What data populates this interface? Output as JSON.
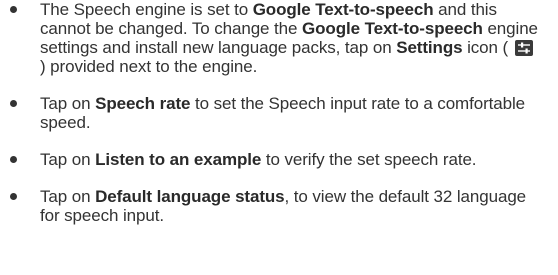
{
  "items": [
    {
      "parts": [
        {
          "t": "The Speech engine is set to ",
          "b": false
        },
        {
          "t": "Google Text-to-speech",
          "b": true
        },
        {
          "t": " and this cannot be changed. To change the ",
          "b": false
        },
        {
          "t": "Google Text-to-speech",
          "b": true
        },
        {
          "t": " engine settings and install new language packs, tap on ",
          "b": false
        },
        {
          "t": "Settings",
          "b": true
        },
        {
          "t": " icon ( ",
          "b": false
        },
        {
          "icon": "settings-sliders-icon"
        },
        {
          "t": " ) provided next to the engine.",
          "b": false
        }
      ]
    },
    {
      "parts": [
        {
          "t": "Tap on ",
          "b": false
        },
        {
          "t": "Speech rate",
          "b": true
        },
        {
          "t": " to set the Speech input rate to a comfortable speed.",
          "b": false
        }
      ]
    },
    {
      "parts": [
        {
          "t": "Tap on ",
          "b": false
        },
        {
          "t": "Listen to an example",
          "b": true
        },
        {
          "t": " to verify the set speech rate.",
          "b": false
        }
      ]
    },
    {
      "parts": [
        {
          "t": "Tap on ",
          "b": false
        },
        {
          "t": "Default language status",
          "b": true
        },
        {
          "t": ", to view the default 32 language for speech input.",
          "b": false
        }
      ]
    }
  ],
  "colors": {
    "text": "#333333",
    "icon_bg": "#3a3a3a"
  }
}
